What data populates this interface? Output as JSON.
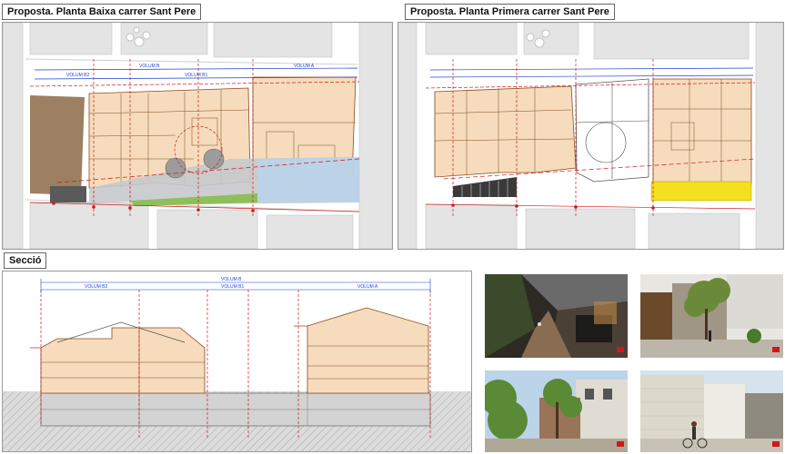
{
  "plan_ground": {
    "title": "Proposta. Planta Baixa carrer Sant Pere",
    "volum_labels": [
      "VOLUM B2",
      "VOLUM B",
      "VOLUM B1",
      "VOLUM A"
    ]
  },
  "plan_first": {
    "title": "Proposta. Planta Primera carrer Sant Pere"
  },
  "section": {
    "title": "Secció",
    "volum_b": "VOLUM B",
    "volum_b2": "VOLUM B2",
    "volum_b1": "VOLUM B1",
    "volum_a": "VOLUM A"
  },
  "colors": {
    "building_fill": "#f6dcbc",
    "building_stroke": "#8a4a20",
    "dimension_line": "#d01818",
    "blue_label": "#1f3fd0",
    "plaza_gray": "#c6c9cc",
    "green_strip": "#8fbf5a",
    "blue_zone": "#b8d3ee",
    "yellow_zone": "#f4e020",
    "basement": "#cfcfcf"
  },
  "photos": [
    {
      "name": "render-passage",
      "scene": "evening-alley"
    },
    {
      "name": "render-courtyard-tree",
      "scene": "courtyard-tree"
    },
    {
      "name": "render-street-trees",
      "scene": "day-street"
    },
    {
      "name": "render-plaza-cyclist",
      "scene": "plaza-cyclist"
    }
  ]
}
